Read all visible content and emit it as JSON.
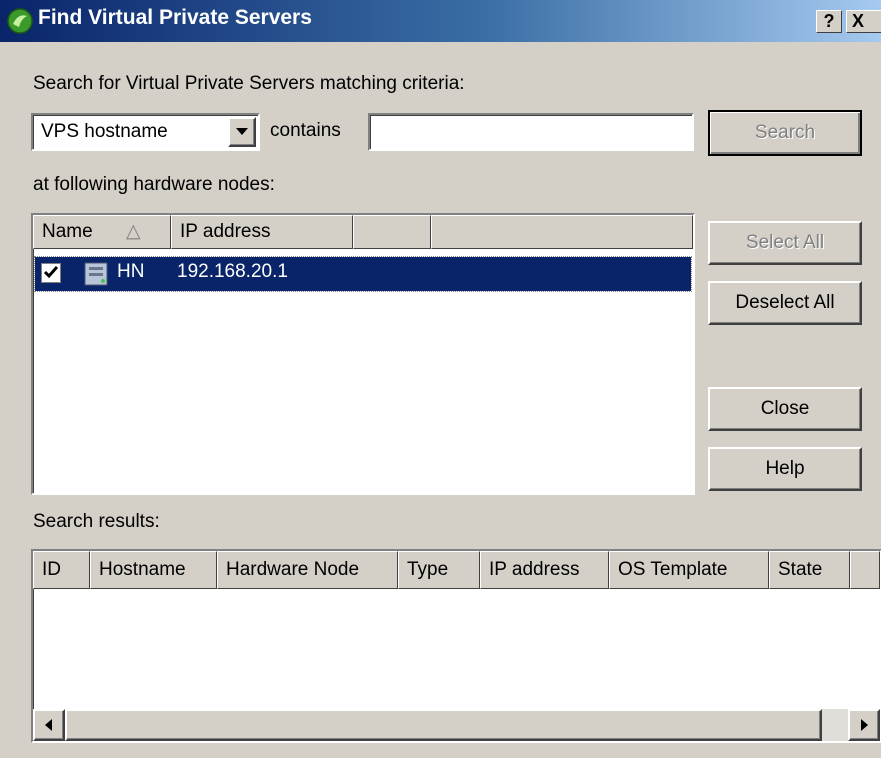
{
  "window": {
    "title": "Find Virtual Private Servers",
    "help_btn": "?",
    "close_btn": "X"
  },
  "criteria": {
    "label": "Search for Virtual Private Servers matching criteria:",
    "field_select_value": "VPS hostname",
    "operator_label": "contains",
    "search_value": "",
    "search_button": "Search"
  },
  "nodes": {
    "label": "at following hardware nodes:",
    "columns": [
      "Name",
      "IP address",
      "",
      ""
    ],
    "sort_indicator": "△",
    "rows": [
      {
        "checked": true,
        "name": "HN",
        "ip": "192.168.20.1",
        "selected": true
      }
    ],
    "select_all": "Select All",
    "deselect_all": "Deselect All"
  },
  "actions": {
    "close": "Close",
    "help": "Help"
  },
  "results": {
    "label": "Search results:",
    "columns": [
      "ID",
      "Hostname",
      "Hardware Node",
      "Type",
      "IP address",
      "OS Template",
      "State",
      ""
    ],
    "rows": []
  },
  "colors": {
    "face": "#D4D0C8",
    "selection": "#0A246A",
    "title_gradient_start": "#0A246A",
    "title_gradient_end": "#A6CAF0"
  }
}
